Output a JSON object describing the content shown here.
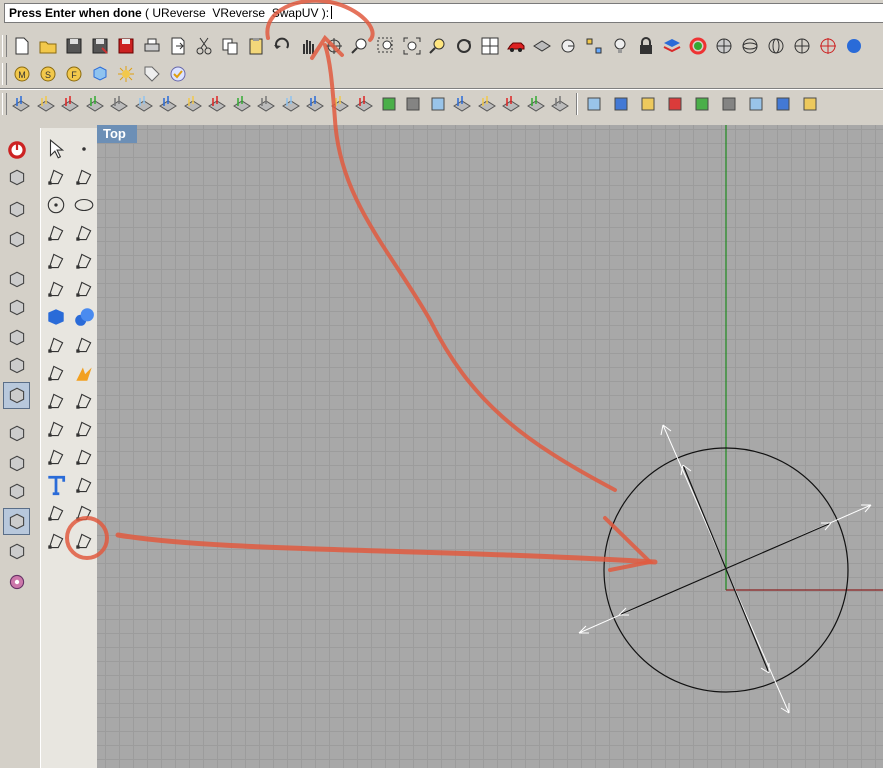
{
  "command_line": {
    "prompt": "Press Enter when done",
    "open_paren": " ( ",
    "options": [
      "UReverse",
      "VReverse",
      "SwapUV"
    ],
    "close": " ):"
  },
  "viewport": {
    "label": "Top",
    "colors": {
      "grid": "#a8a8a8",
      "x_axis": "#8b2222",
      "y_axis": "#1e8a1e",
      "annotation": "#e05a40"
    }
  },
  "toolbar_main": [
    "new-file-icon",
    "open-folder-icon",
    "save-icon",
    "save-as-icon",
    "save-small-icon",
    "print-icon",
    "export-icon",
    "cut-icon",
    "copy-icon",
    "paste-icon",
    "undo-icon",
    "pan-hand-icon",
    "rotate-view-icon",
    "zoom-dynamic-icon",
    "zoom-window-icon",
    "zoom-extents-icon",
    "zoom-selected-icon",
    "rotate-camera-icon",
    "four-viewports-icon",
    "car-render-icon",
    "grid-icon",
    "circle-snap-icon",
    "points-icon",
    "light-bulb-icon",
    "lock-icon",
    "layer-icon",
    "color-wheel-icon",
    "shade-sphere-icon",
    "wire-sphere-icon",
    "mesh-sphere-icon",
    "render-sphere-icon",
    "target-icon",
    "globe-icon"
  ],
  "toolbar_second": [
    "macro-m-icon",
    "macro-s-icon",
    "macro-f-icon",
    "cube-icon",
    "sun-icon",
    "tag-icon",
    "check-icon"
  ],
  "toolbar_third": [
    "grid-op-1-icon",
    "grid-op-2-icon",
    "grid-op-3-icon",
    "grid-op-4-icon",
    "grid-op-5-icon",
    "grid-op-6-icon",
    "grid-op-7-icon",
    "grid-op-8-icon",
    "grid-op-9-icon",
    "grid-op-10-icon",
    "grid-op-11-icon",
    "grid-op-12-icon",
    "grid-op-13-icon",
    "grid-op-14-icon",
    "grid-op-15-icon",
    "folder-icon",
    "eye-icon",
    "down-arrow-icon",
    "grid-op-16-icon",
    "grid-op-17-icon",
    "grid-op-18-icon",
    "grid-op-19-icon",
    "grid-op-20-icon",
    "shapes-icon",
    "shapes-alt-icon",
    "contrast-icon",
    "yellow-cube-icon",
    "curve-icon",
    "cylinder-icon",
    "id-tag-icon",
    "yellow-box-icon",
    "color-circles-icon"
  ],
  "left_column": [
    "stop-icon",
    "propeller-icon",
    "globe-wire-icon",
    "molecule-icon",
    "axes-icon",
    "box-view-1-icon",
    "box-view-2-icon",
    "box-view-3-icon",
    "box-view-active-icon",
    "eraser-icon",
    "layers-icon",
    "paint-bucket-icon",
    "frame-icon",
    "walker-icon",
    "gear-icon"
  ],
  "palette": [
    "select-arrow-icon",
    "point-icon",
    "polyline-icon",
    "curve-edit-icon",
    "circle-icon",
    "ellipse-icon",
    "arc-icon",
    "rectangle-icon",
    "polygon-icon",
    "fillet-icon",
    "surface-patch-icon",
    "surface-blend-icon",
    "solid-box-icon",
    "solid-sphere-icon",
    "cylinder-surface-icon",
    "plane-surface-icon",
    "puzzle-icon",
    "explode-icon",
    "trim-icon",
    "split-icon",
    "boolean-icon",
    "group-icon",
    "curve-arrow-icon",
    "curve-arrow-alt-icon",
    "text-icon",
    "scale-icon",
    "array-icon",
    "transform-icon",
    "extrude-icon",
    "dir-analysis-icon"
  ]
}
